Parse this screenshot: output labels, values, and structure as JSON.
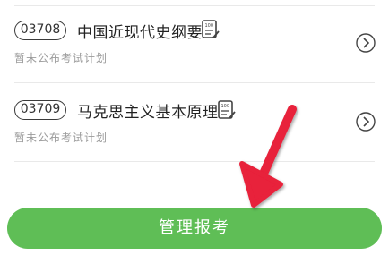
{
  "courses": [
    {
      "code": "03708",
      "name": "中国近现代史纲要",
      "status": "暂未公布考试计划"
    },
    {
      "code": "03709",
      "name": "马克思主义基本原理",
      "status": "暂未公布考试计划"
    }
  ],
  "footer": {
    "manage_label": "管理报考"
  },
  "colors": {
    "accent_green": "#5fbe56",
    "arrow_red": "#e8203a"
  }
}
